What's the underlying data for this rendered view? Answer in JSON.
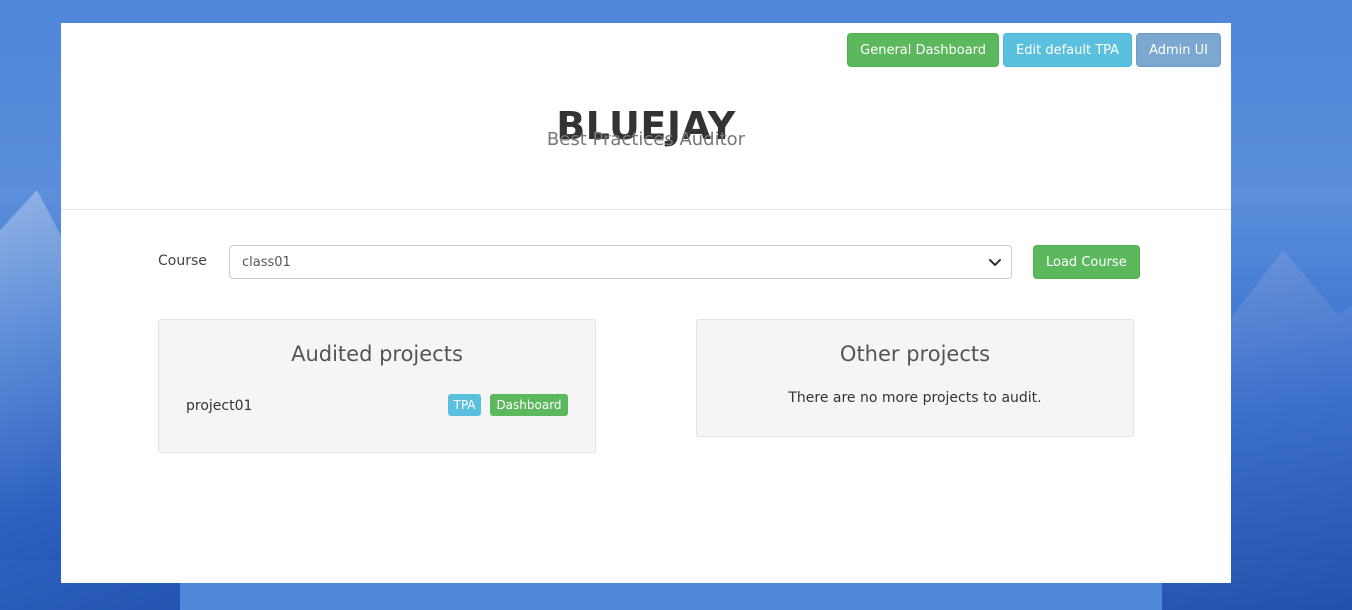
{
  "header": {
    "title": "BLUEJAY",
    "subtitle": "Best Practices Auditor"
  },
  "top_buttons": {
    "general_dashboard": "General Dashboard",
    "edit_default_tpa": "Edit default TPA",
    "admin_ui": "Admin UI"
  },
  "course": {
    "label": "Course",
    "selected": "class01",
    "load_button": "Load Course"
  },
  "audited_projects": {
    "title": "Audited projects",
    "items": [
      {
        "name": "project01",
        "tpa_label": "TPA",
        "dashboard_label": "Dashboard"
      }
    ]
  },
  "other_projects": {
    "title": "Other projects",
    "empty_message": "There are no more projects to audit."
  },
  "colors": {
    "success": "#5cb85c",
    "info": "#5bc0de",
    "admin": "#7ba7d1",
    "background_blue": "#4f86d8"
  },
  "icons": {
    "select_chevron": "chevron-down-icon"
  }
}
